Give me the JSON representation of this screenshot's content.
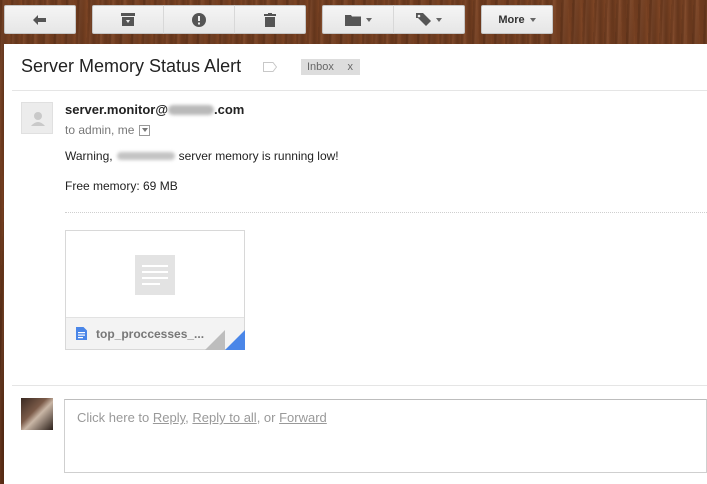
{
  "toolbar": {
    "buttons": [
      {
        "icon": "back-arrow-icon"
      },
      {
        "icon": "archive-icon"
      },
      {
        "icon": "report-spam-icon"
      },
      {
        "icon": "delete-icon"
      },
      {
        "icon": "folder-icon"
      },
      {
        "icon": "label-tag-icon"
      }
    ],
    "more_label": "More"
  },
  "message": {
    "subject": "Server Memory Status Alert",
    "label_chip": "Inbox",
    "label_chip_close": "x",
    "sender_prefix": "server.monitor@",
    "sender_suffix": ".com",
    "to_line": "to admin, me",
    "body_prefix": "Warning,",
    "body_suffix": "server memory is running low!",
    "free_memory": "Free memory: 69 MB",
    "attachment_name": "top_proccesses_..."
  },
  "reply": {
    "prefix": "Click here to ",
    "reply": "Reply",
    "sep1": ", ",
    "reply_all": "Reply to all",
    "sep2": ", or ",
    "forward": "Forward"
  },
  "colors": {
    "background_wood": "#6b3a1f",
    "button_face": "#eeeeee",
    "attachment_corner": "#4a86e8"
  }
}
